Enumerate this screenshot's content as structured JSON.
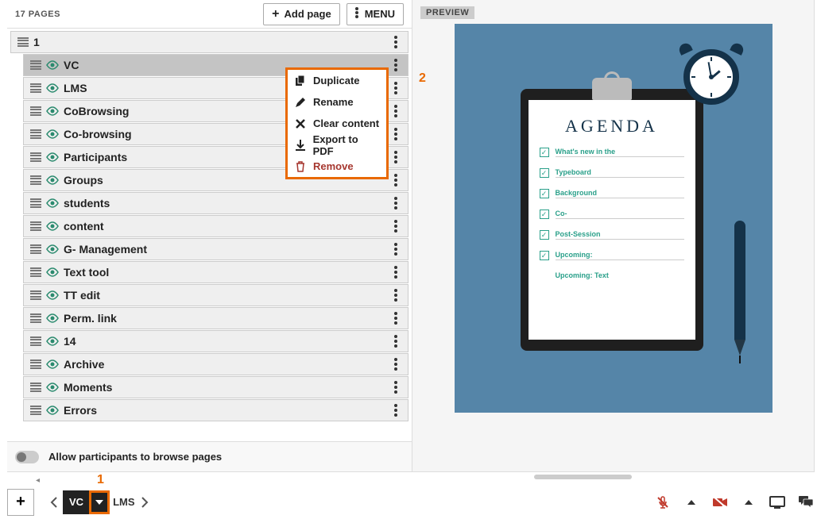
{
  "header": {
    "page_count_label": "17 PAGES",
    "add_page_label": "Add page",
    "menu_label": "MENU"
  },
  "pages": [
    {
      "label": "1",
      "indent": false,
      "selected": false
    },
    {
      "label": "VC",
      "indent": true,
      "selected": true
    },
    {
      "label": "LMS",
      "indent": true,
      "selected": false
    },
    {
      "label": "CoBrowsing",
      "indent": true,
      "selected": false
    },
    {
      "label": "Co-browsing",
      "indent": true,
      "selected": false
    },
    {
      "label": "Participants",
      "indent": true,
      "selected": false
    },
    {
      "label": "Groups",
      "indent": true,
      "selected": false
    },
    {
      "label": "students",
      "indent": true,
      "selected": false
    },
    {
      "label": "content",
      "indent": true,
      "selected": false
    },
    {
      "label": "G- Management",
      "indent": true,
      "selected": false
    },
    {
      "label": "Text tool",
      "indent": true,
      "selected": false
    },
    {
      "label": "TT edit",
      "indent": true,
      "selected": false
    },
    {
      "label": "Perm. link",
      "indent": true,
      "selected": false
    },
    {
      "label": "14",
      "indent": true,
      "selected": false
    },
    {
      "label": "Archive",
      "indent": true,
      "selected": false
    },
    {
      "label": "Moments",
      "indent": true,
      "selected": false
    },
    {
      "label": "Errors",
      "indent": true,
      "selected": false
    }
  ],
  "context_menu": {
    "duplicate": "Duplicate",
    "rename": "Rename",
    "clear": "Clear content",
    "export_pdf": "Export to PDF",
    "remove": "Remove"
  },
  "allow_browse_label": "Allow participants to browse pages",
  "preview": {
    "badge": "PREVIEW",
    "agenda_title": "AGENDA",
    "items": [
      "What's new in the",
      "Typeboard",
      "Background",
      "Co-",
      "Post-Session",
      "Upcoming:",
      "Upcoming: Text"
    ]
  },
  "bottom_bar": {
    "current_label": "VC",
    "next_label": "LMS"
  },
  "annotations": {
    "one": "1",
    "two": "2"
  },
  "colors": {
    "highlight": "#e96900",
    "agenda_accent": "#2aa08a",
    "preview_bg": "#5585a8",
    "clipboard": "#1f1f1f"
  }
}
